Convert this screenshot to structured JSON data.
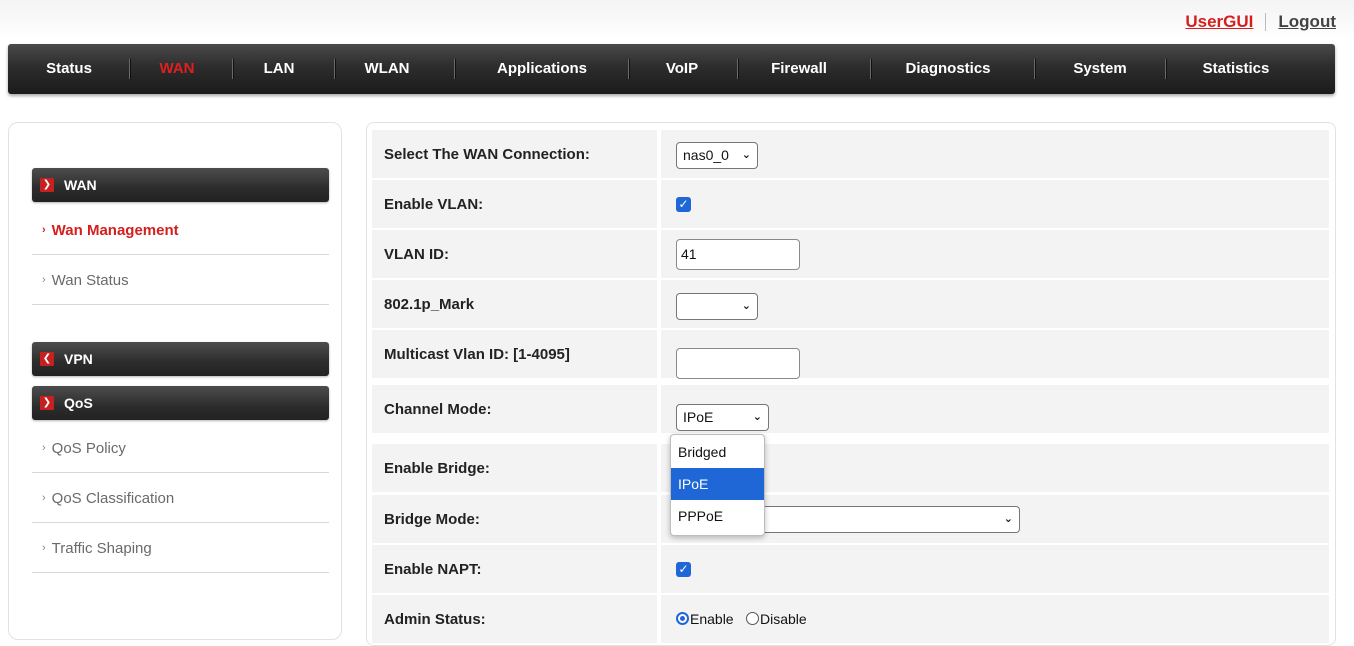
{
  "header": {
    "links": {
      "usergui": "UserGUI",
      "logout": "Logout"
    }
  },
  "nav": {
    "items": [
      "Status",
      "WAN",
      "LAN",
      "WLAN",
      "Applications",
      "VoIP",
      "Firewall",
      "Diagnostics",
      "System",
      "Statistics"
    ],
    "active": "WAN"
  },
  "sidebar": {
    "wan_header": "WAN",
    "wan_management": "Wan Management",
    "wan_status": "Wan Status",
    "vpn_header": "VPN",
    "qos_header": "QoS",
    "qos_policy": "QoS Policy",
    "qos_classification": "QoS Classification",
    "traffic_shaping": "Traffic Shaping"
  },
  "form": {
    "wan_connection": {
      "label": "Select The WAN Connection:",
      "value": "nas0_0"
    },
    "enable_vlan": {
      "label": "Enable VLAN:",
      "checked": true
    },
    "vlan_id": {
      "label": "VLAN ID:",
      "value": "41"
    },
    "mark_8021p": {
      "label": "802.1p_Mark",
      "value": ""
    },
    "multicast_vlan": {
      "label": "Multicast Vlan ID: [1-4095]",
      "value": ""
    },
    "channel_mode": {
      "label": "Channel Mode:",
      "value": "IPoE",
      "options": [
        "Bridged",
        "IPoE",
        "PPPoE"
      ],
      "highlighted": "IPoE"
    },
    "enable_bridge": {
      "label": "Enable Bridge:"
    },
    "bridge_mode": {
      "label": "Bridge Mode:",
      "value": ""
    },
    "enable_napt": {
      "label": "Enable NAPT:",
      "checked": true
    },
    "admin_status": {
      "label": "Admin Status:",
      "enable": "Enable",
      "disable": "Disable",
      "selected": "Enable"
    }
  },
  "colors": {
    "accent_red": "#d61e1e",
    "checkbox_blue": "#1f66d6"
  }
}
